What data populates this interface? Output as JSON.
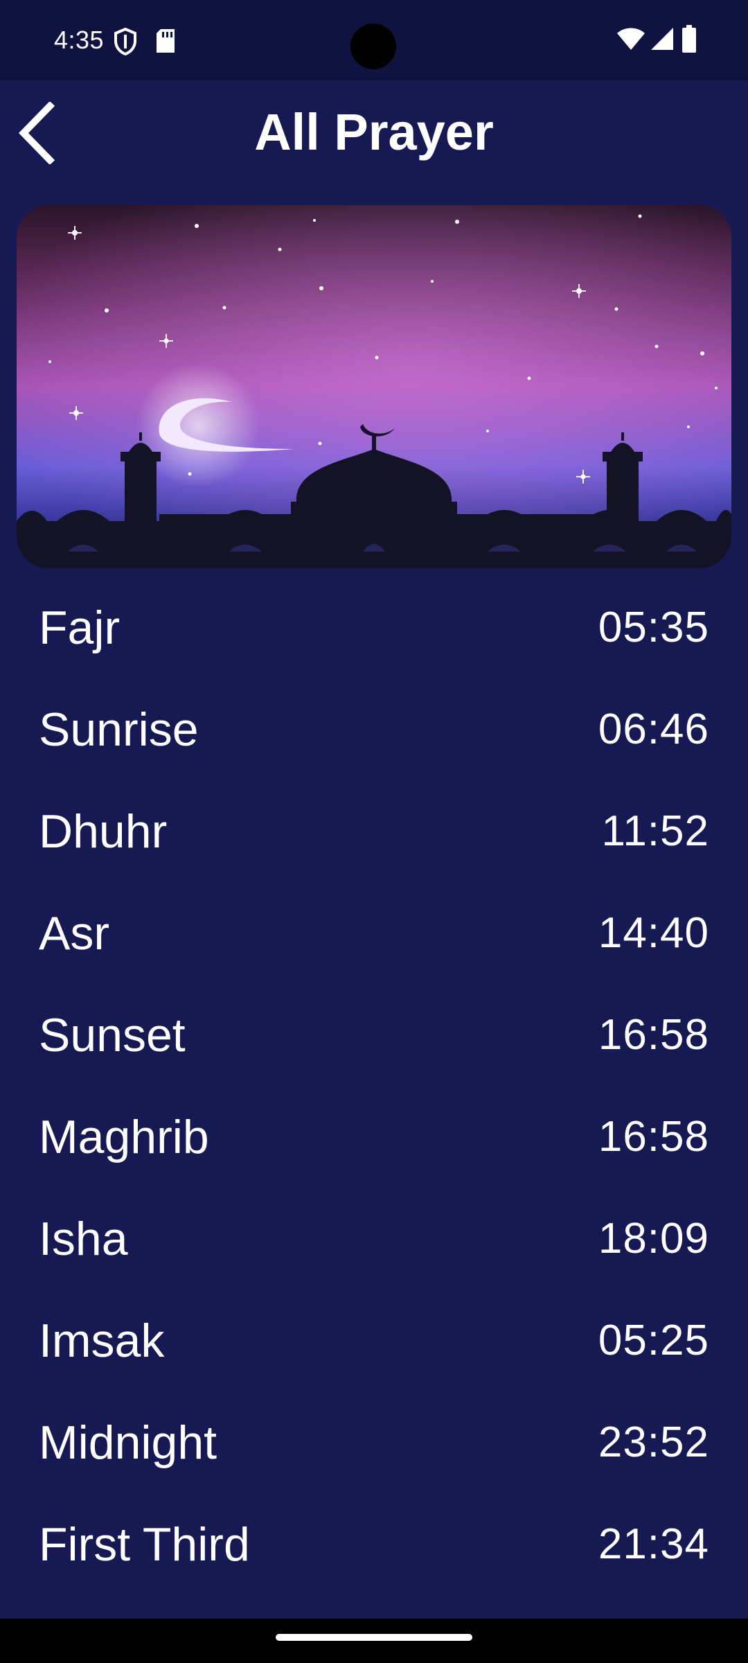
{
  "status_bar": {
    "time": "4:35",
    "icons": [
      "shield-icon",
      "sd-card-icon",
      "wifi-icon",
      "signal-icon",
      "battery-icon"
    ]
  },
  "app_bar": {
    "title": "All Prayer",
    "back_icon": "chevron-left-icon"
  },
  "banner": {
    "description_icon": "mosque-crescent-night-image"
  },
  "prayers": [
    {
      "name": "Fajr",
      "time": "05:35"
    },
    {
      "name": "Sunrise",
      "time": "06:46"
    },
    {
      "name": "Dhuhr",
      "time": "11:52"
    },
    {
      "name": "Asr",
      "time": "14:40"
    },
    {
      "name": "Sunset",
      "time": "16:58"
    },
    {
      "name": "Maghrib",
      "time": "16:58"
    },
    {
      "name": "Isha",
      "time": "18:09"
    },
    {
      "name": "Imsak",
      "time": "05:25"
    },
    {
      "name": "Midnight",
      "time": "23:52"
    },
    {
      "name": "First Third",
      "time": "21:34"
    }
  ],
  "colors": {
    "background": "#171a52",
    "status_bar": "#10133f",
    "text": "#ffffff"
  }
}
